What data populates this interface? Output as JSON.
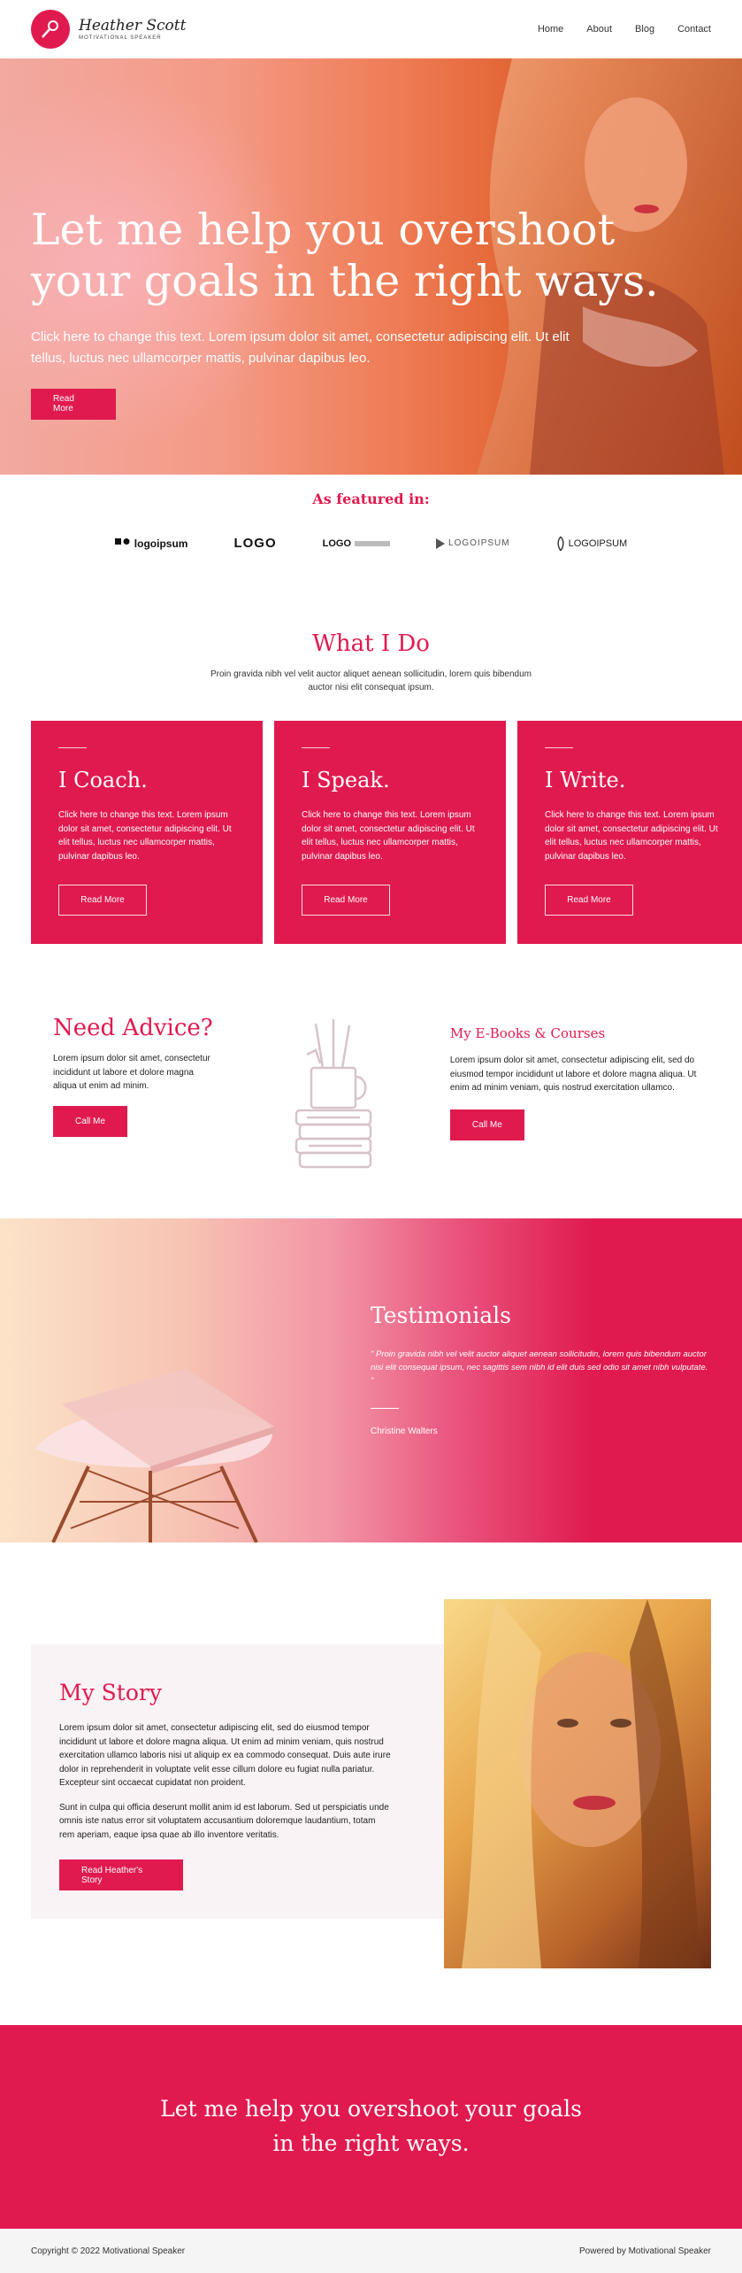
{
  "brand": {
    "name": "Heather Scott",
    "tagline": "MOTIVATIONAL SPEAKER"
  },
  "nav": {
    "items": [
      {
        "label": "Home"
      },
      {
        "label": "About"
      },
      {
        "label": "Blog"
      },
      {
        "label": "Contact"
      }
    ]
  },
  "hero": {
    "title": "Let me help you overshoot your goals in the right ways.",
    "subtitle": "Click here to change this text. Lorem ipsum dolor sit amet, consectetur adipiscing elit. Ut elit tellus, luctus nec ullamcorper mattis, pulvinar dapibus leo.",
    "button": "Read More"
  },
  "featured": {
    "title": "As featured in:",
    "logos": [
      "logoipsum",
      "LOGO",
      "LOGO",
      "LOGOIPSUM",
      "LOGOIPSUM"
    ]
  },
  "whatido": {
    "title": "What I Do",
    "subtitle": "Proin gravida nibh vel velit auctor aliquet aenean sollicitudin, lorem quis bibendum auctor nisi elit consequat ipsum.",
    "cards": [
      {
        "title": "I Coach.",
        "text": "Click here to change this text. Lorem ipsum dolor sit amet, consectetur adipiscing elit. Ut elit tellus, luctus nec ullamcorper mattis, pulvinar dapibus leo.",
        "button": "Read More"
      },
      {
        "title": "I Speak.",
        "text": "Click here to change this text. Lorem ipsum dolor sit amet, consectetur adipiscing elit. Ut elit tellus, luctus nec ullamcorper mattis, pulvinar dapibus leo.",
        "button": "Read More"
      },
      {
        "title": "I Write.",
        "text": "Click here to change this text. Lorem ipsum dolor sit amet, consectetur adipiscing elit. Ut elit tellus, luctus nec ullamcorper mattis, pulvinar dapibus leo.",
        "button": "Read More"
      }
    ]
  },
  "advice": {
    "title": "Need Advice?",
    "text": "Lorem ipsum dolor sit amet, consectetur incididunt ut labore et dolore magna aliqua ut enim ad minim.",
    "button": "Call Me"
  },
  "ebooks": {
    "title": "My E-Books & Courses",
    "text": "Lorem ipsum dolor sit amet, consectetur adipiscing elit, sed do eiusmod tempor incididunt ut labore et dolore magna aliqua. Ut enim ad minim veniam, quis nostrud exercitation ullamco.",
    "button": "Call Me"
  },
  "testimonials": {
    "title": "Testimonials",
    "quote": "\" Proin gravida nibh vel velit auctor aliquet aenean sollicitudin, lorem quis bibendum auctor nisi elit consequat ipsum, nec sagittis sem nibh id elit duis sed odio sit amet nibh vulputate. \"",
    "author": "Christine Walters"
  },
  "story": {
    "title": "My Story",
    "paragraph1": "Lorem ipsum dolor sit amet, consectetur adipiscing elit, sed do eiusmod tempor incididunt ut labore et dolore magna aliqua. Ut enim ad minim veniam, quis nostrud exercitation ullamco laboris nisi ut aliquip ex ea commodo consequat. Duis aute irure dolor in reprehenderit in voluptate velit esse cillum dolore eu fugiat nulla pariatur. Excepteur sint occaecat cupidatat non proident.",
    "paragraph2": "Sunt in culpa qui officia deserunt mollit anim id est laborum. Sed ut perspiciatis unde omnis iste natus error sit voluptatem accusantium doloremque laudantium, totam rem aperiam, eaque ipsa quae ab illo inventore veritatis.",
    "button": "Read Heather's Story"
  },
  "cta": {
    "text": "Let me help you overshoot your goals in the right ways."
  },
  "footer": {
    "copyright": "Copyright © 2022 Motivational Speaker",
    "powered": "Powered by Motivational Speaker"
  },
  "colors": {
    "accent": "#e01a4f"
  },
  "icons": {
    "logo": "microphone-icon",
    "illustration": "books-mug-icon"
  }
}
